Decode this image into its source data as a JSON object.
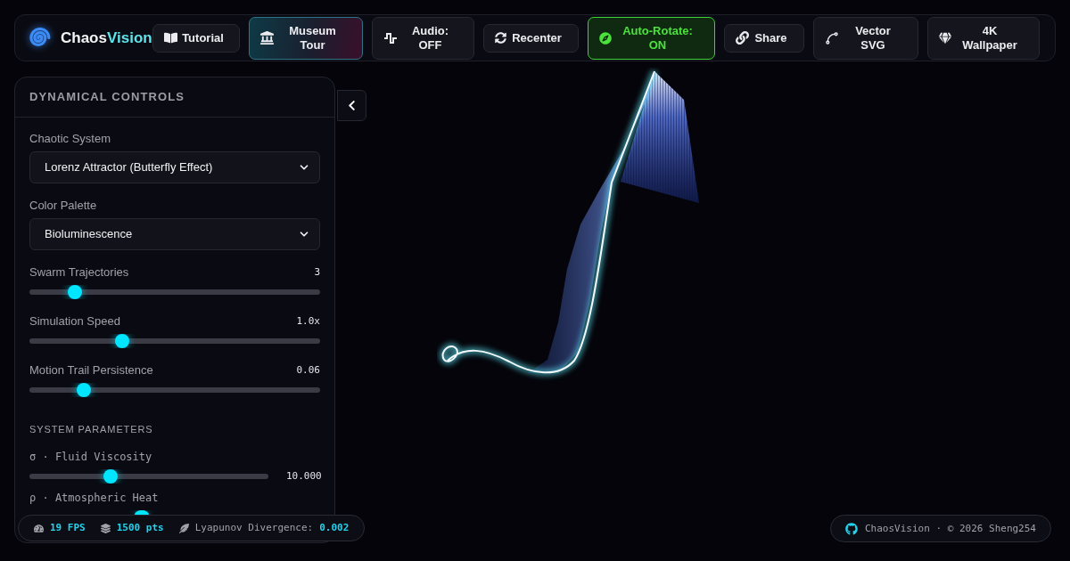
{
  "brand": {
    "first": "Chaos",
    "second": "Vision"
  },
  "toolbar": {
    "buttons": [
      {
        "label": "Tutorial",
        "kind": "plain"
      },
      {
        "label": "Museum Tour",
        "kind": "featured"
      },
      {
        "label": "Audio: OFF",
        "kind": "toggle",
        "on": false
      },
      {
        "label": "Recenter",
        "kind": "plain"
      },
      {
        "label": "Auto-Rotate: ON",
        "kind": "toggle",
        "on": true
      },
      {
        "label": "Share",
        "kind": "plain"
      },
      {
        "label": "Vector SVG",
        "kind": "plain"
      },
      {
        "label": "4K Wallpaper",
        "kind": "plain"
      }
    ]
  },
  "panel": {
    "title": "DYNAMICAL CONTROLS",
    "selects": [
      {
        "label": "Chaotic System",
        "value": "Lorenz Attractor (Butterfly Effect)"
      },
      {
        "label": "Color Palette",
        "value": "Bioluminescence"
      }
    ],
    "sliders": [
      {
        "label": "Swarm Trajectories",
        "reading": "3",
        "level": 0.14
      },
      {
        "label": "Simulation Speed",
        "reading": "1.0x",
        "level": 0.31
      },
      {
        "label": "Motion Trail Persistence",
        "reading": "0.06",
        "level": 0.17
      }
    ],
    "parameters": {
      "title": "SYSTEM PARAMETERS",
      "items": [
        {
          "label": "σ · Fluid Viscosity",
          "reading": "10.000",
          "level": 0.33
        },
        {
          "label": "ρ · Atmospheric Heat",
          "level": 0.47
        }
      ]
    }
  },
  "stats": {
    "fps": "19 FPS",
    "points": "1500 pts",
    "divergence_label": "Lyapunov Divergence:",
    "divergence_value": "0.002"
  },
  "footer": {
    "credit": "ChaosVision · © 2026 Sheng254"
  }
}
